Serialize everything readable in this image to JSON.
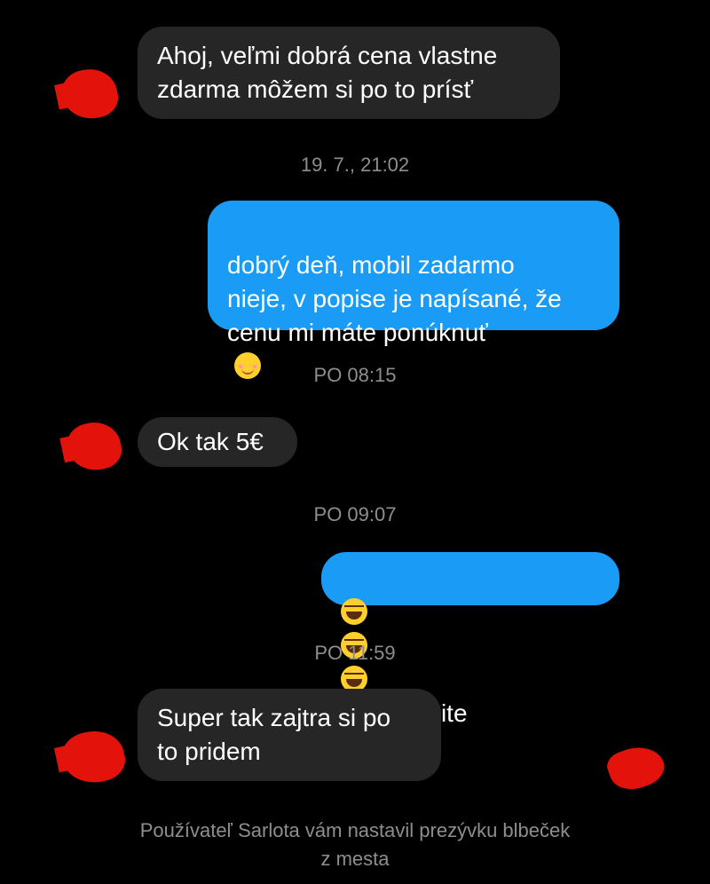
{
  "messages": [
    {
      "id": "m1",
      "from": "them",
      "text": "Ahoj, veľmi dobrá cena vlastne\nzdarma môžem si po to prísť"
    },
    {
      "id": "m2",
      "from": "me",
      "text": "dobrý deň, mobil zadarmo\nnieje, v popise je napísané, že\ncenu mi máte ponúknuť",
      "emoji": "smiling-face-emoji"
    },
    {
      "id": "m3",
      "from": "them",
      "text": "Ok tak 5€"
    },
    {
      "id": "m4",
      "from": "me",
      "text": "no to určite",
      "emoji": "tears-of-joy-emoji"
    },
    {
      "id": "m5",
      "from": "them",
      "text": "Super tak zajtra si po\nto pridem"
    }
  ],
  "timestamps": {
    "t1": "19. 7., 21:02",
    "t2": "PO 08:15",
    "t3": "PO 09:07",
    "t4": "PO 11:59"
  },
  "system_notice": "Používateľ Sarlota vám nastavil prezývku blbeček\nz mesta",
  "colors": {
    "background": "#000000",
    "incoming_bubble": "#262626",
    "outgoing_bubble": "#1a9bf5",
    "timestamp_text": "#8e8e8e",
    "redaction": "#e3120b"
  }
}
